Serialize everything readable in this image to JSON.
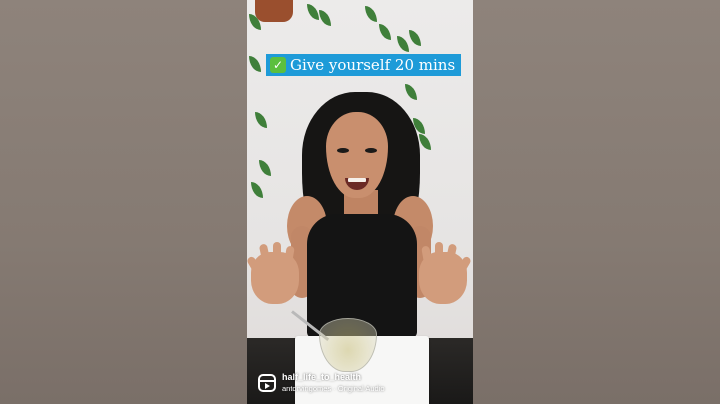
{
  "video": {
    "caption": {
      "emoji_icon": "check-mark-button-icon",
      "text": "Give yourself 20 mins",
      "background": "#1e9bd8"
    },
    "attribution": {
      "icon": "instagram-reels-icon",
      "handle": "half_life_to_health",
      "audio_line": "antorvingomes · Original Audio"
    }
  },
  "colors": {
    "side_blur": "#8a7f77",
    "caption_bg": "#1e9bd8",
    "check_green": "#5cbf3e"
  }
}
